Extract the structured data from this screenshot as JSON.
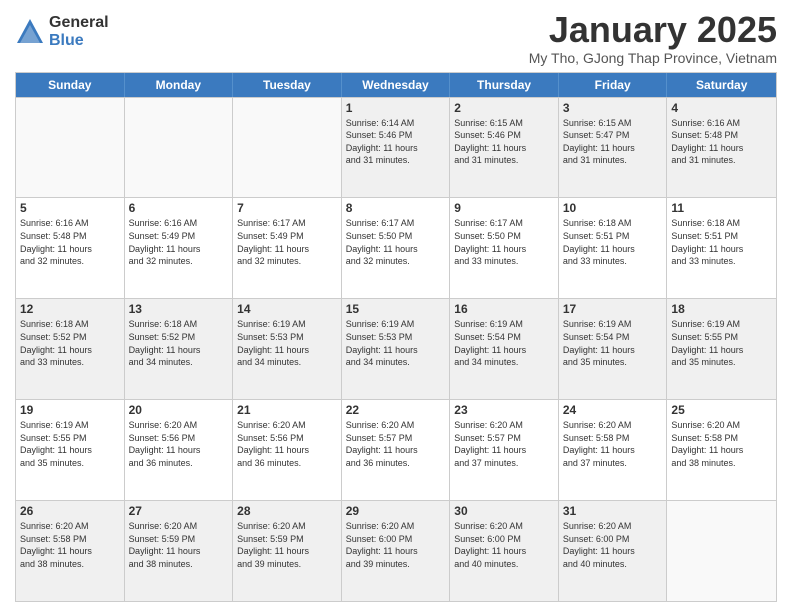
{
  "logo": {
    "general": "General",
    "blue": "Blue"
  },
  "title": "January 2025",
  "subtitle": "My Tho, GJong Thap Province, Vietnam",
  "days_of_week": [
    "Sunday",
    "Monday",
    "Tuesday",
    "Wednesday",
    "Thursday",
    "Friday",
    "Saturday"
  ],
  "weeks": [
    [
      {
        "day": "",
        "info": "",
        "empty": true
      },
      {
        "day": "",
        "info": "",
        "empty": true
      },
      {
        "day": "",
        "info": "",
        "empty": true
      },
      {
        "day": "1",
        "info": "Sunrise: 6:14 AM\nSunset: 5:46 PM\nDaylight: 11 hours\nand 31 minutes.",
        "empty": false
      },
      {
        "day": "2",
        "info": "Sunrise: 6:15 AM\nSunset: 5:46 PM\nDaylight: 11 hours\nand 31 minutes.",
        "empty": false
      },
      {
        "day": "3",
        "info": "Sunrise: 6:15 AM\nSunset: 5:47 PM\nDaylight: 11 hours\nand 31 minutes.",
        "empty": false
      },
      {
        "day": "4",
        "info": "Sunrise: 6:16 AM\nSunset: 5:48 PM\nDaylight: 11 hours\nand 31 minutes.",
        "empty": false
      }
    ],
    [
      {
        "day": "5",
        "info": "Sunrise: 6:16 AM\nSunset: 5:48 PM\nDaylight: 11 hours\nand 32 minutes.",
        "empty": false
      },
      {
        "day": "6",
        "info": "Sunrise: 6:16 AM\nSunset: 5:49 PM\nDaylight: 11 hours\nand 32 minutes.",
        "empty": false
      },
      {
        "day": "7",
        "info": "Sunrise: 6:17 AM\nSunset: 5:49 PM\nDaylight: 11 hours\nand 32 minutes.",
        "empty": false
      },
      {
        "day": "8",
        "info": "Sunrise: 6:17 AM\nSunset: 5:50 PM\nDaylight: 11 hours\nand 32 minutes.",
        "empty": false
      },
      {
        "day": "9",
        "info": "Sunrise: 6:17 AM\nSunset: 5:50 PM\nDaylight: 11 hours\nand 33 minutes.",
        "empty": false
      },
      {
        "day": "10",
        "info": "Sunrise: 6:18 AM\nSunset: 5:51 PM\nDaylight: 11 hours\nand 33 minutes.",
        "empty": false
      },
      {
        "day": "11",
        "info": "Sunrise: 6:18 AM\nSunset: 5:51 PM\nDaylight: 11 hours\nand 33 minutes.",
        "empty": false
      }
    ],
    [
      {
        "day": "12",
        "info": "Sunrise: 6:18 AM\nSunset: 5:52 PM\nDaylight: 11 hours\nand 33 minutes.",
        "empty": false
      },
      {
        "day": "13",
        "info": "Sunrise: 6:18 AM\nSunset: 5:52 PM\nDaylight: 11 hours\nand 34 minutes.",
        "empty": false
      },
      {
        "day": "14",
        "info": "Sunrise: 6:19 AM\nSunset: 5:53 PM\nDaylight: 11 hours\nand 34 minutes.",
        "empty": false
      },
      {
        "day": "15",
        "info": "Sunrise: 6:19 AM\nSunset: 5:53 PM\nDaylight: 11 hours\nand 34 minutes.",
        "empty": false
      },
      {
        "day": "16",
        "info": "Sunrise: 6:19 AM\nSunset: 5:54 PM\nDaylight: 11 hours\nand 34 minutes.",
        "empty": false
      },
      {
        "day": "17",
        "info": "Sunrise: 6:19 AM\nSunset: 5:54 PM\nDaylight: 11 hours\nand 35 minutes.",
        "empty": false
      },
      {
        "day": "18",
        "info": "Sunrise: 6:19 AM\nSunset: 5:55 PM\nDaylight: 11 hours\nand 35 minutes.",
        "empty": false
      }
    ],
    [
      {
        "day": "19",
        "info": "Sunrise: 6:19 AM\nSunset: 5:55 PM\nDaylight: 11 hours\nand 35 minutes.",
        "empty": false
      },
      {
        "day": "20",
        "info": "Sunrise: 6:20 AM\nSunset: 5:56 PM\nDaylight: 11 hours\nand 36 minutes.",
        "empty": false
      },
      {
        "day": "21",
        "info": "Sunrise: 6:20 AM\nSunset: 5:56 PM\nDaylight: 11 hours\nand 36 minutes.",
        "empty": false
      },
      {
        "day": "22",
        "info": "Sunrise: 6:20 AM\nSunset: 5:57 PM\nDaylight: 11 hours\nand 36 minutes.",
        "empty": false
      },
      {
        "day": "23",
        "info": "Sunrise: 6:20 AM\nSunset: 5:57 PM\nDaylight: 11 hours\nand 37 minutes.",
        "empty": false
      },
      {
        "day": "24",
        "info": "Sunrise: 6:20 AM\nSunset: 5:58 PM\nDaylight: 11 hours\nand 37 minutes.",
        "empty": false
      },
      {
        "day": "25",
        "info": "Sunrise: 6:20 AM\nSunset: 5:58 PM\nDaylight: 11 hours\nand 38 minutes.",
        "empty": false
      }
    ],
    [
      {
        "day": "26",
        "info": "Sunrise: 6:20 AM\nSunset: 5:58 PM\nDaylight: 11 hours\nand 38 minutes.",
        "empty": false
      },
      {
        "day": "27",
        "info": "Sunrise: 6:20 AM\nSunset: 5:59 PM\nDaylight: 11 hours\nand 38 minutes.",
        "empty": false
      },
      {
        "day": "28",
        "info": "Sunrise: 6:20 AM\nSunset: 5:59 PM\nDaylight: 11 hours\nand 39 minutes.",
        "empty": false
      },
      {
        "day": "29",
        "info": "Sunrise: 6:20 AM\nSunset: 6:00 PM\nDaylight: 11 hours\nand 39 minutes.",
        "empty": false
      },
      {
        "day": "30",
        "info": "Sunrise: 6:20 AM\nSunset: 6:00 PM\nDaylight: 11 hours\nand 40 minutes.",
        "empty": false
      },
      {
        "day": "31",
        "info": "Sunrise: 6:20 AM\nSunset: 6:00 PM\nDaylight: 11 hours\nand 40 minutes.",
        "empty": false
      },
      {
        "day": "",
        "info": "",
        "empty": true
      }
    ]
  ]
}
